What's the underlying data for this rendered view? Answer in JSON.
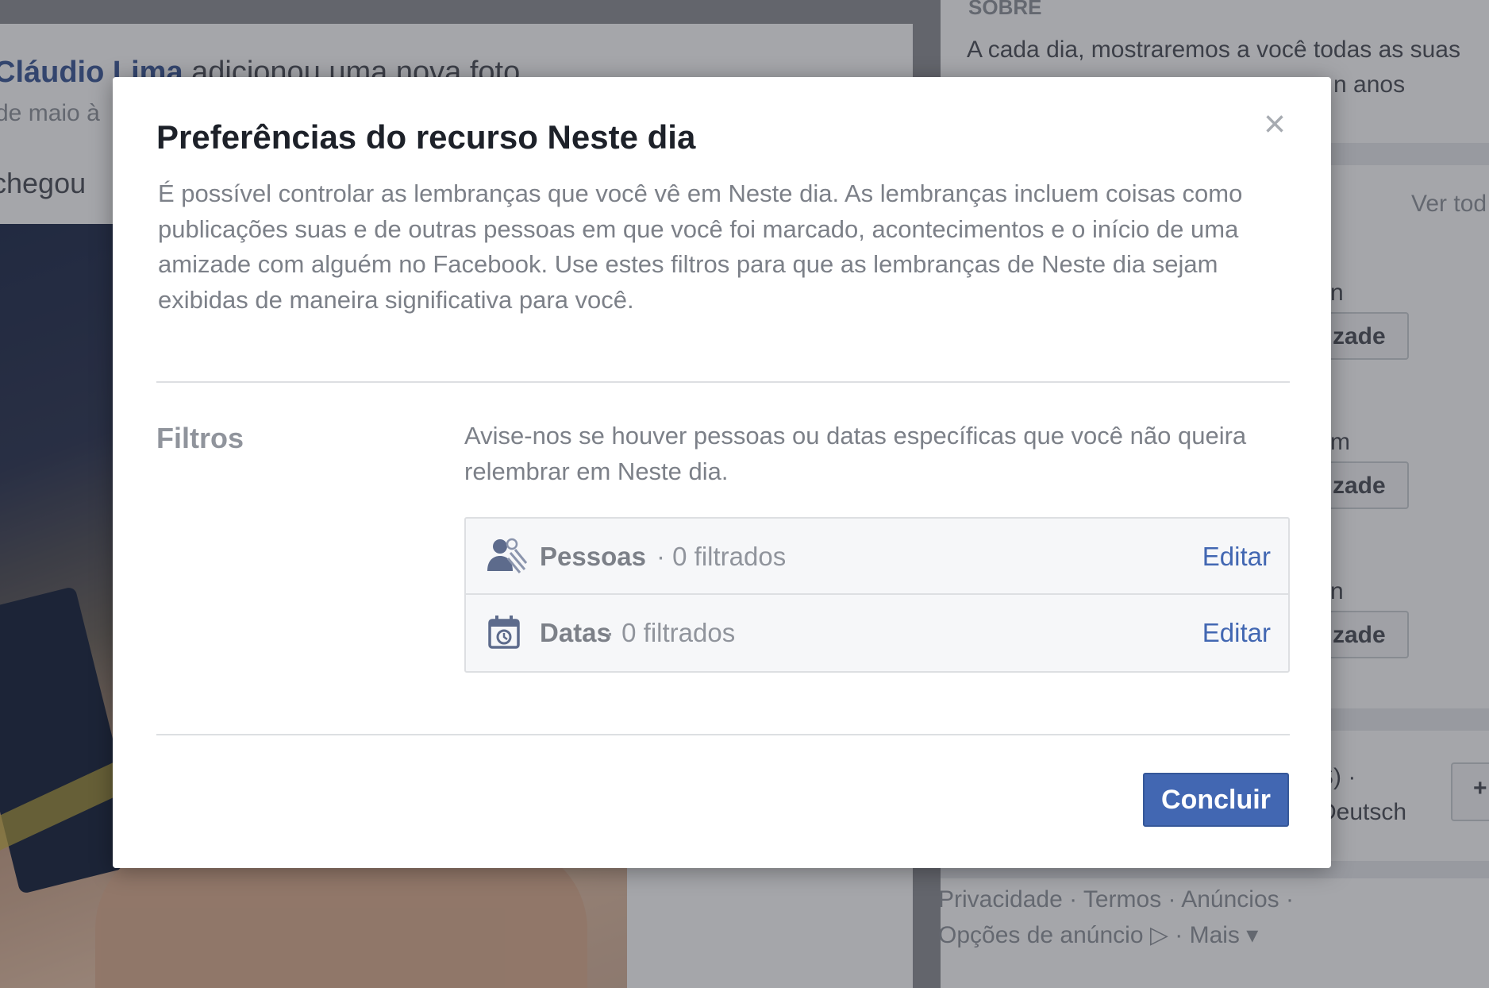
{
  "background": {
    "feed": {
      "post_line1_author": "Cláudio Lima",
      "post_line1_action": "adicionou uma nova foto.",
      "post_line2": "de maio à",
      "post_line3": "chegou"
    },
    "right_column": {
      "section_title": "SOBRE",
      "about_line1": "A cada dia, mostraremos a você todas as suas",
      "about_line2": "n anos",
      "see_all": "Ver tod",
      "item_fragments": [
        "n",
        "m",
        "n"
      ],
      "button_label": "zade",
      "lang_line1": "S) ·",
      "lang_line2": "Deutsch",
      "plus": "+"
    },
    "footer": {
      "line1": "Privacidade · Termos · Anúncios ·",
      "line2": "Opções de anúncio ▷ · Mais ▾"
    }
  },
  "dialog": {
    "title": "Preferências do recurso Neste dia",
    "close_icon": "×",
    "description": "É possível controlar as lembranças que você vê em Neste dia. As lembranças incluem coisas como publicações suas e de outras pessoas em que você foi marcado, acontecimentos e o início de uma amizade com alguém no Facebook. Use estes filtros para que as lembranças de Neste dia sejam exibidas de maneira significativa para você.",
    "filters": {
      "label": "Filtros",
      "description": "Avise-nos se houver pessoas ou datas específicas que você não queira relembrar em Neste dia.",
      "items": [
        {
          "icon": "people-icon",
          "name": "Pessoas",
          "count": "· 0 filtrados",
          "action": "Editar"
        },
        {
          "icon": "calendar-icon",
          "name": "Datas",
          "count": "· 0 filtrados",
          "action": "Editar"
        }
      ]
    },
    "primary_button": "Concluir",
    "colors": {
      "accent": "#4267b2",
      "title_text": "#1d2129",
      "secondary_text": "#7c8088",
      "divider": "#dddfe2"
    }
  }
}
